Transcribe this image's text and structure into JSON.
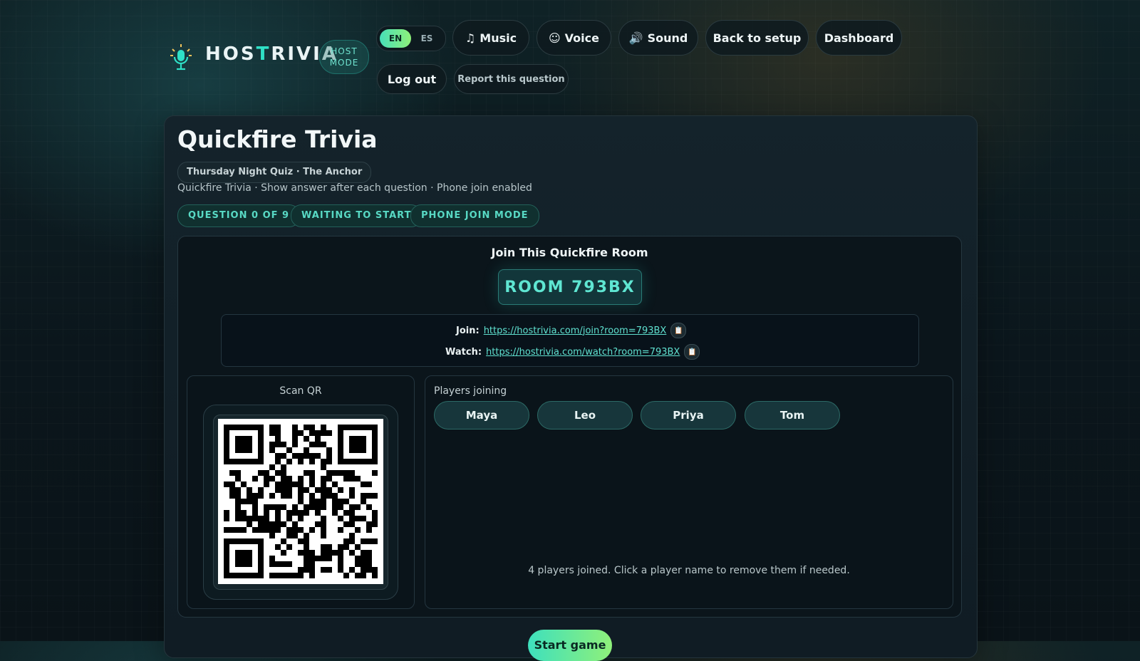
{
  "header": {
    "logo_prefix": "HOS",
    "logo_accent": "T",
    "logo_suffix": "RIVIA",
    "host_mode_line1": "HOST",
    "host_mode_line2": "MODE",
    "lang_options": [
      "EN",
      "ES"
    ],
    "lang_selected": "EN",
    "music_label": "Music",
    "voice_label": "Voice",
    "sound_label": "Sound",
    "back_label": "Back to setup",
    "dashboard_label": "Dashboard",
    "logout_label": "Log out",
    "report_label": "Report this question",
    "icons": {
      "logo": "microphone-icon",
      "music": "music-note-icon",
      "voice": "speaking-head-icon",
      "sound": "speaker-icon"
    }
  },
  "game": {
    "title": "Quickfire Trivia",
    "subtitle": "Thursday Night Quiz · The Anchor",
    "meta": "Quickfire Trivia · Show answer after each question · Phone join enabled",
    "chips": [
      "QUESTION 0 OF 9",
      "WAITING TO START",
      "PHONE JOIN MODE"
    ]
  },
  "join": {
    "heading": "Join This Quickfire Room",
    "room_code": "ROOM 793BX",
    "join_label": "Join:",
    "join_url": "https://hostrivia.com/join?room=793BX",
    "watch_label": "Watch:",
    "watch_url": "https://hostrivia.com/watch?room=793BX",
    "copy_icon": "clipboard-icon"
  },
  "qr": {
    "label": "Scan QR"
  },
  "players": {
    "label": "Players joining",
    "names": [
      "Maya",
      "Leo",
      "Priya",
      "Tom"
    ],
    "note": "4 players joined. Click a player name to remove them if needed."
  },
  "start": {
    "label": "Start game"
  },
  "colors": {
    "accent": "#2fe0c6",
    "accent_green": "#8ff07a",
    "background": "#0b161c"
  }
}
